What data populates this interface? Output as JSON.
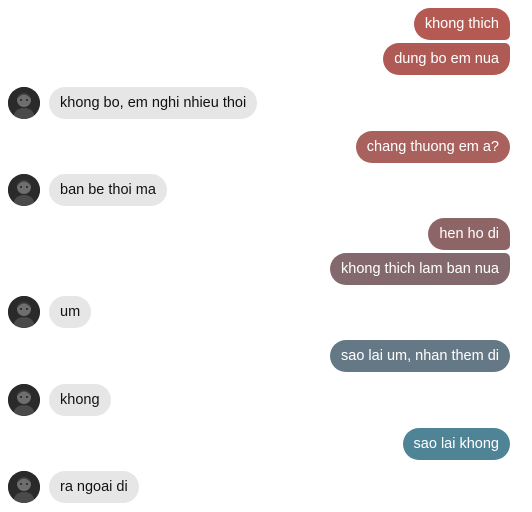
{
  "messages": [
    {
      "id": "m1",
      "side": "sent",
      "text": "khong thich",
      "color": "#b55a52"
    },
    {
      "id": "m2",
      "side": "sent",
      "text": "dung bo em nua",
      "color": "#b05a55"
    },
    {
      "id": "m3",
      "side": "received",
      "text": "khong bo, em nghi nhieu thoi"
    },
    {
      "id": "m4",
      "side": "sent",
      "text": "chang thuong em a?",
      "color": "#a8615c"
    },
    {
      "id": "m5",
      "side": "received",
      "text": "ban be thoi ma"
    },
    {
      "id": "m6",
      "side": "sent",
      "text": "hen ho di",
      "color": "#8d6566"
    },
    {
      "id": "m7",
      "side": "sent",
      "text": "khong thich lam ban nua",
      "color": "#83696e"
    },
    {
      "id": "m8",
      "side": "received",
      "text": "um"
    },
    {
      "id": "m9",
      "side": "sent",
      "text": "sao lai um, nhan them di",
      "color": "#657886"
    },
    {
      "id": "m10",
      "side": "received",
      "text": "khong"
    },
    {
      "id": "m11",
      "side": "sent",
      "text": "sao lai khong",
      "color": "#4f8497"
    },
    {
      "id": "m12",
      "side": "received",
      "text": "ra ngoai di"
    }
  ],
  "contact": {
    "avatar_icon": "user-avatar-icon"
  }
}
